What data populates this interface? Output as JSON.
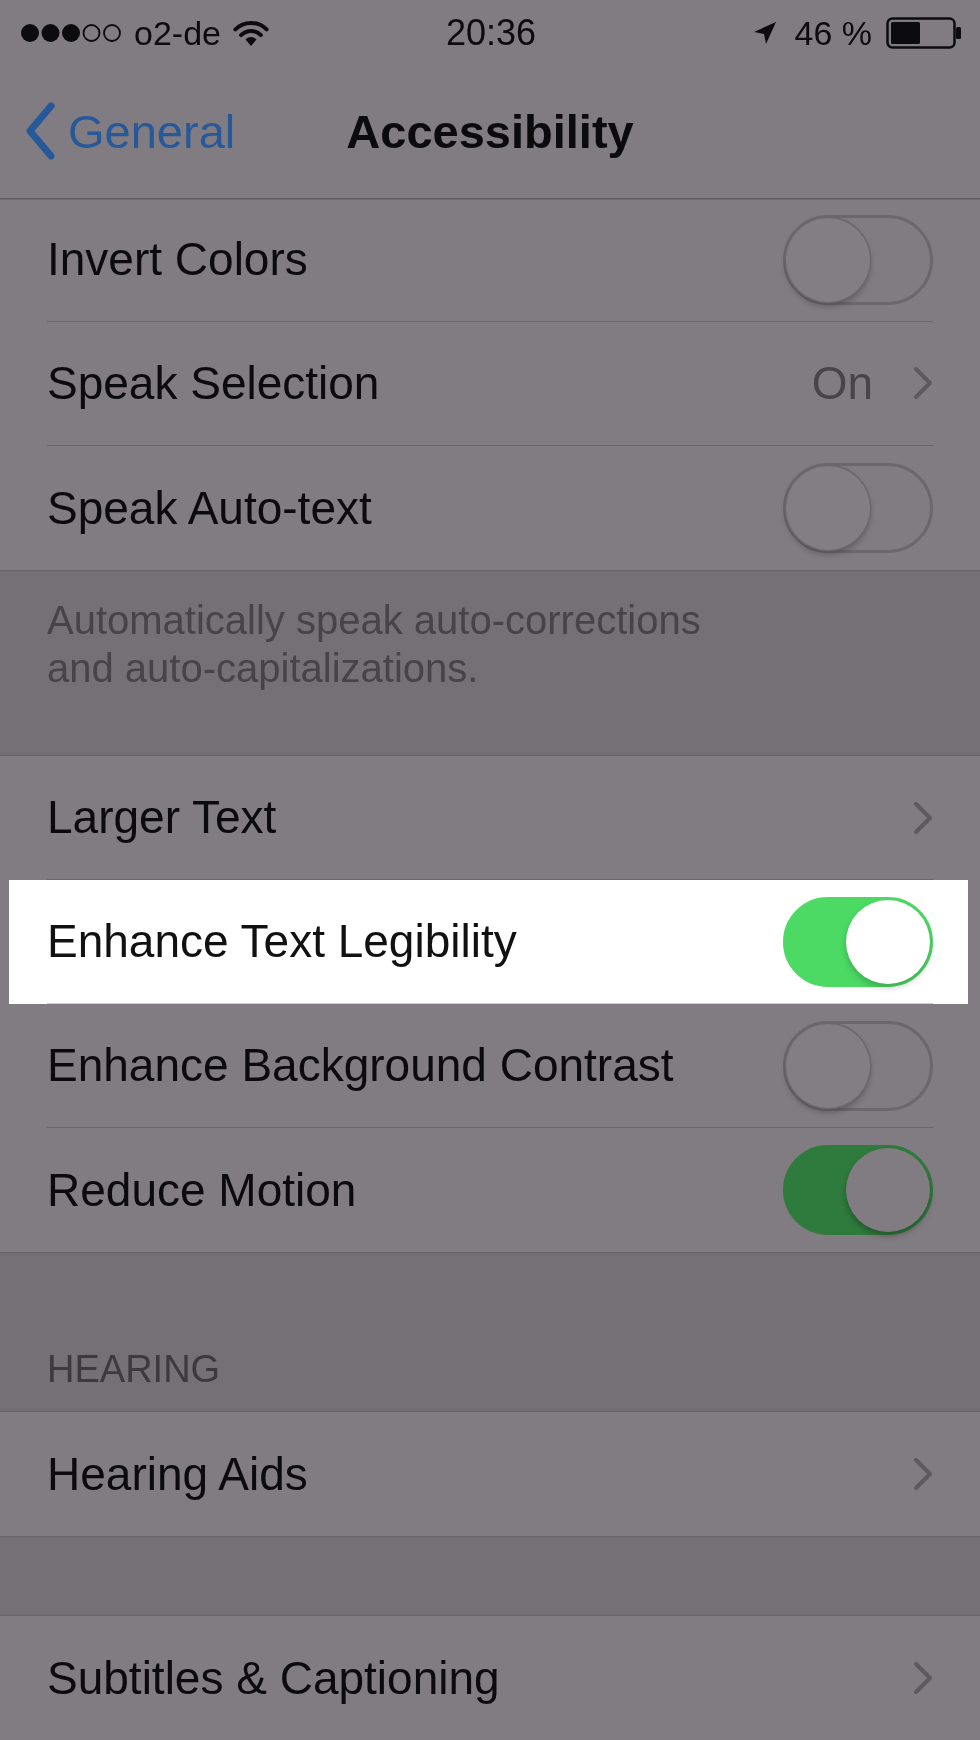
{
  "status_bar": {
    "carrier": "o2-de",
    "time": "20:36",
    "battery": "46 %"
  },
  "nav_bar": {
    "back": "General",
    "title": "Accessibility"
  },
  "groups": [
    {
      "rows": [
        {
          "kind": "toggle",
          "label": "Invert Colors",
          "on": false,
          "highlighted": false
        },
        {
          "kind": "link",
          "label": "Speak Selection",
          "value": "On",
          "highlighted": false
        },
        {
          "kind": "toggle",
          "label": "Speak Auto-text",
          "on": false,
          "highlighted": false
        }
      ],
      "footer": "Automatically speak auto-corrections and auto-capitalizations."
    },
    {
      "rows": [
        {
          "kind": "link",
          "label": "Larger Text",
          "highlighted": false
        },
        {
          "kind": "toggle",
          "label": "Enhance Text Legibility",
          "on": true,
          "highlighted": true
        },
        {
          "kind": "toggle",
          "label": "Enhance Background Contrast",
          "on": false,
          "highlighted": false
        },
        {
          "kind": "toggle",
          "label": "Reduce Motion",
          "on": true,
          "highlighted": false
        }
      ]
    },
    {
      "header": "HEARING",
      "rows": [
        {
          "kind": "link",
          "label": "Hearing Aids",
          "highlighted": false
        }
      ]
    },
    {
      "rows": [
        {
          "kind": "link",
          "label": "Subtitles & Captioning",
          "highlighted": false
        }
      ]
    }
  ]
}
